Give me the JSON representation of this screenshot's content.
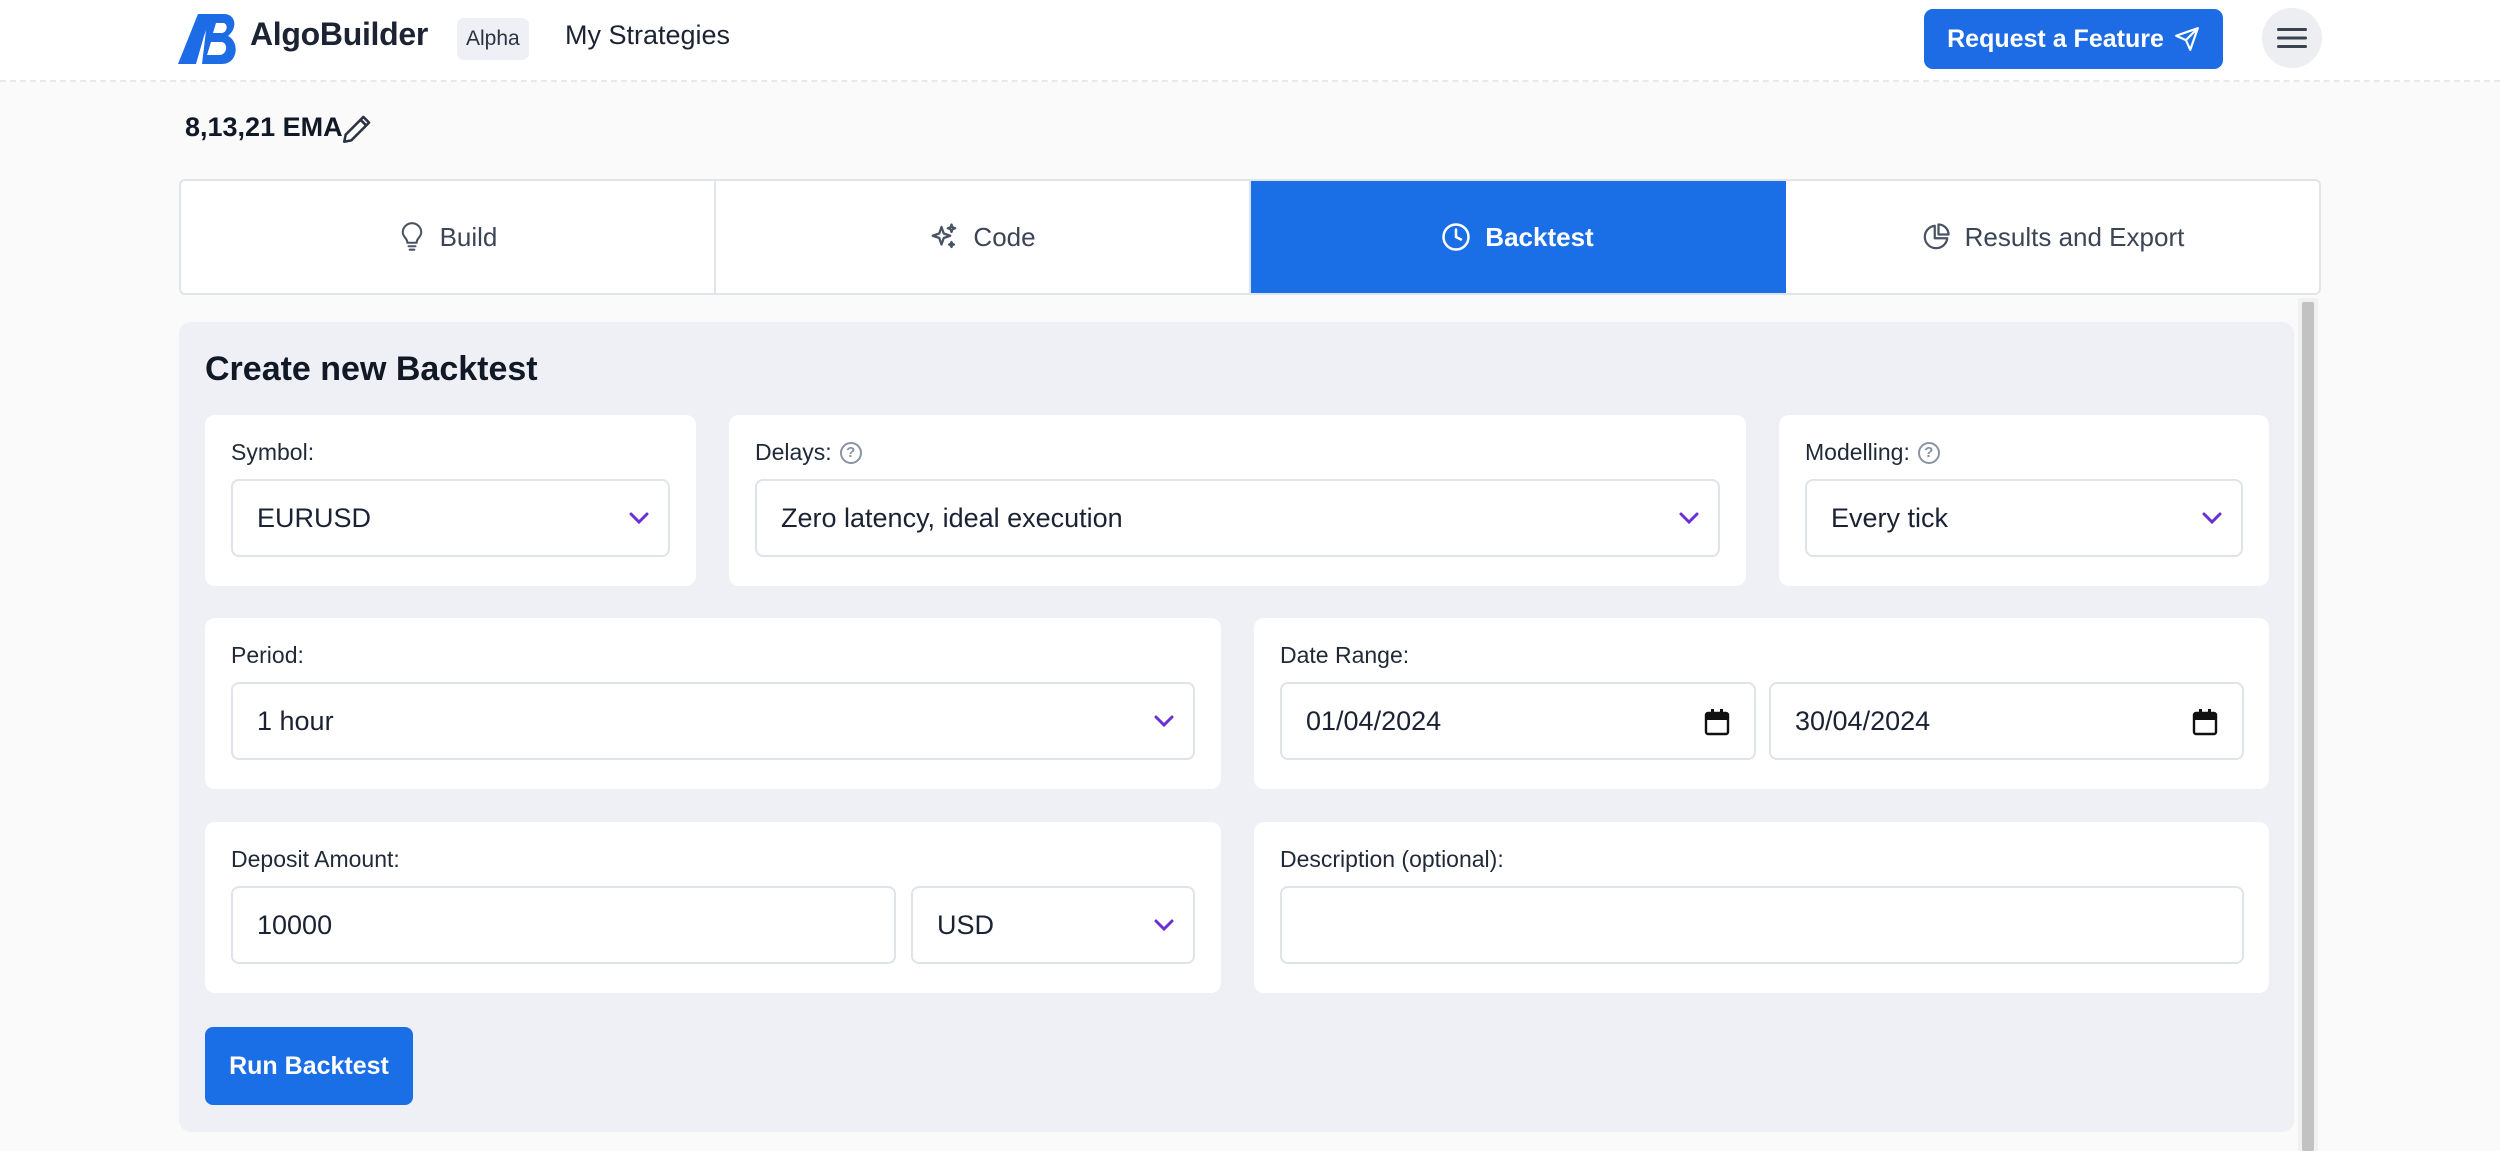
{
  "header": {
    "brand": "AlgoBuilder",
    "badge": "Alpha",
    "nav_link": "My Strategies",
    "request_button": "Request a Feature"
  },
  "strategy": {
    "name": "8,13,21 EMA"
  },
  "tabs": [
    {
      "label": "Build",
      "icon": "lightbulb-icon",
      "active": false
    },
    {
      "label": "Code",
      "icon": "sparkles-icon",
      "active": false
    },
    {
      "label": "Backtest",
      "icon": "clock-icon",
      "active": true
    },
    {
      "label": "Results and Export",
      "icon": "pie-chart-icon",
      "active": false
    }
  ],
  "backtest_form": {
    "title": "Create new Backtest",
    "symbol": {
      "label": "Symbol:",
      "value": "EURUSD"
    },
    "delays": {
      "label": "Delays:",
      "value": "Zero latency, ideal execution"
    },
    "modelling": {
      "label": "Modelling:",
      "value": "Every tick"
    },
    "period": {
      "label": "Period:",
      "value": "1 hour"
    },
    "date_range": {
      "label": "Date Range:",
      "start": "01/04/2024",
      "end": "30/04/2024"
    },
    "deposit": {
      "label": "Deposit Amount:",
      "amount": "10000",
      "currency": "USD"
    },
    "description": {
      "label": "Description (optional):",
      "value": ""
    },
    "run_button": "Run Backtest"
  },
  "colors": {
    "primary": "#1a6fe6",
    "panel_bg": "#eef0f5",
    "chevron": "#6b2fd6"
  }
}
